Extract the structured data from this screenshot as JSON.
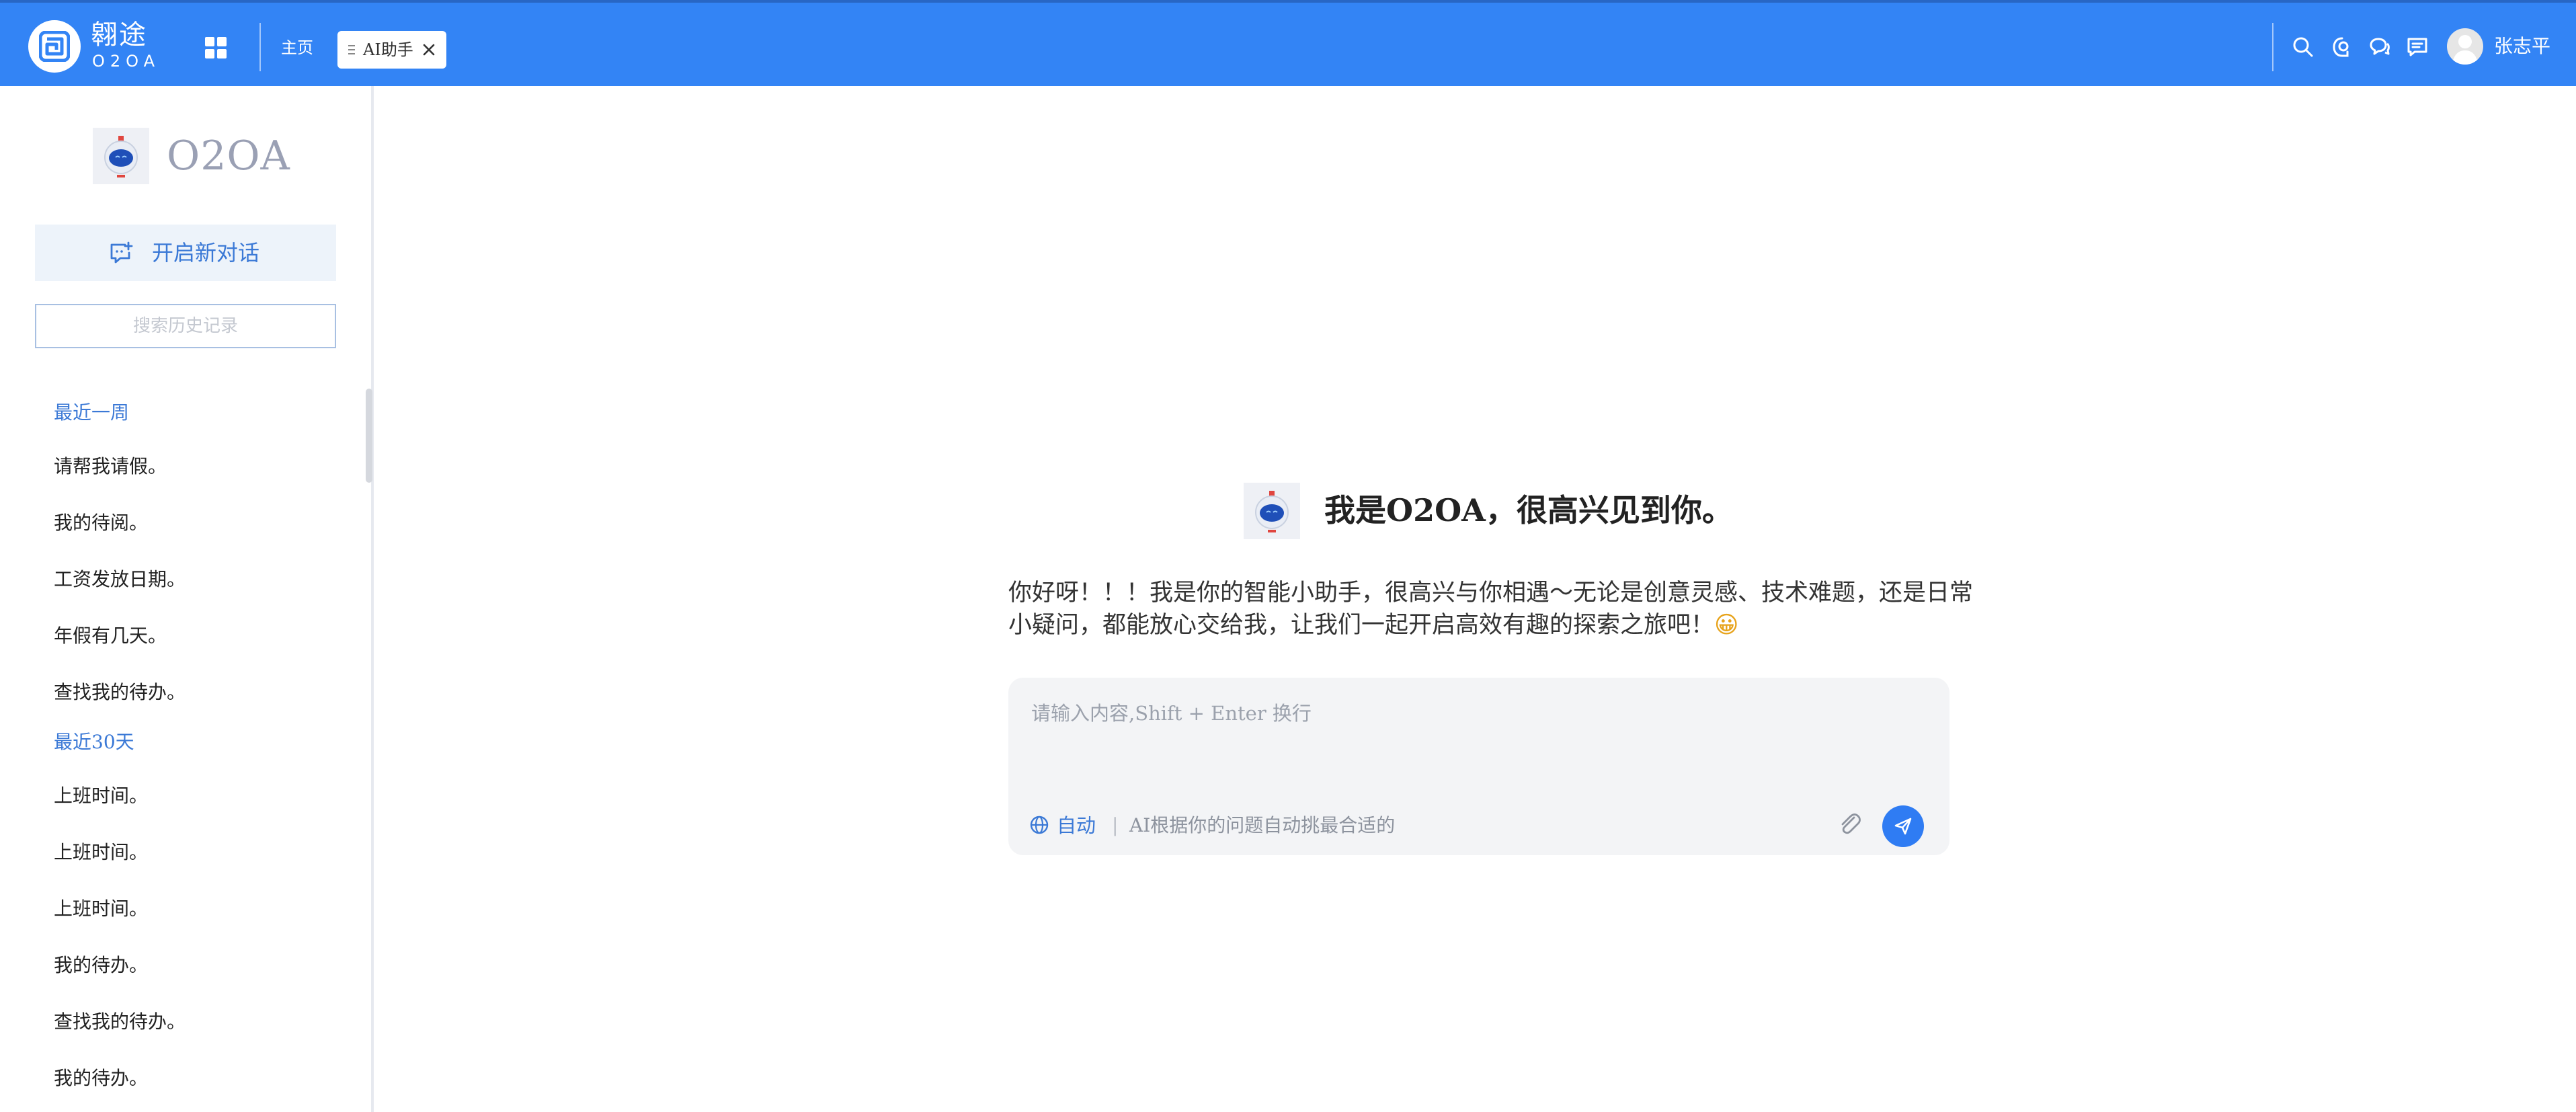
{
  "brand": {
    "name_cn": "翱途",
    "name_en": "O2OA"
  },
  "topbar": {
    "apps_icon": "grid-icon",
    "home_label": "主页",
    "active_tab": "AI助手",
    "icons": [
      "search-icon",
      "robot-icon",
      "chat-bubbles-icon",
      "message-icon"
    ],
    "user_name": "张志平"
  },
  "sidebar": {
    "title": "O2OA",
    "new_chat_label": "开启新对话",
    "search_placeholder": "搜索历史记录",
    "groups": [
      {
        "label": "最近一周",
        "items": [
          "请帮我请假。",
          "我的待阅。",
          "工资发放日期。",
          "年假有几天。",
          "查找我的待办。"
        ]
      },
      {
        "label": "最近30天",
        "items": [
          "上班时间。",
          "上班时间。",
          "上班时间。",
          "我的待办。",
          "查找我的待办。",
          "我的待办。"
        ]
      }
    ]
  },
  "main": {
    "welcome_title": "我是O2OA，很高兴见到你。",
    "intro_text": "你好呀！！！我是你的智能小助手，很高兴与你相遇～无论是创意灵感、技术难题，还是日常小疑问，都能放心交给我，让我们一起开启高效有趣的探索之旅吧！",
    "intro_emoji": "😀",
    "composer": {
      "placeholder": "请输入内容,Shift + Enter 换行",
      "mode_label": "自动",
      "mode_separator": "|",
      "mode_description": "AI根据你的问题自动挑最合适的"
    }
  },
  "colors": {
    "topbar": "#3384f5",
    "accent": "#3b79d6",
    "send_button": "#2f7cf3"
  }
}
